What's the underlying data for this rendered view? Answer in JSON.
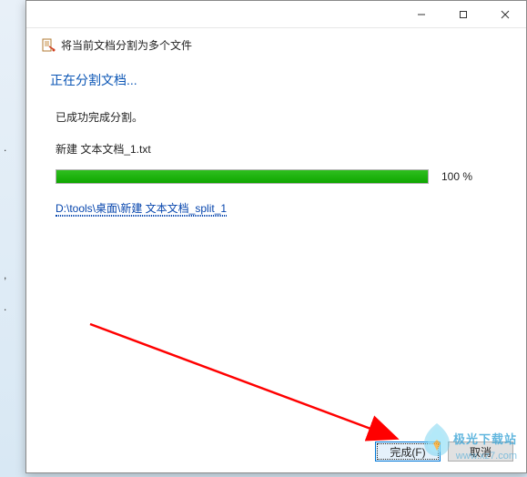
{
  "window": {
    "subtitle": "将当前文档分割为多个文件"
  },
  "content": {
    "heading": "正在分割文档...",
    "status_done": "已成功完成分割。",
    "filename": "新建 文本文档_1.txt",
    "progress_percent_label": "100 %",
    "progress_percent_value": 100,
    "output_path": "D:\\tools\\桌面\\新建 文本文档_split_1"
  },
  "buttons": {
    "finish": "完成(F)",
    "cancel": "取消"
  },
  "watermark": {
    "line1": "极光下载站",
    "line2": "www.xz7.com"
  },
  "colors": {
    "heading": "#0a55b5",
    "progress_fill": "#0fa600",
    "link": "#0645ad",
    "button_focus_border": "#0078d7"
  },
  "edge_text": {
    "comma": ",",
    "period": "."
  }
}
